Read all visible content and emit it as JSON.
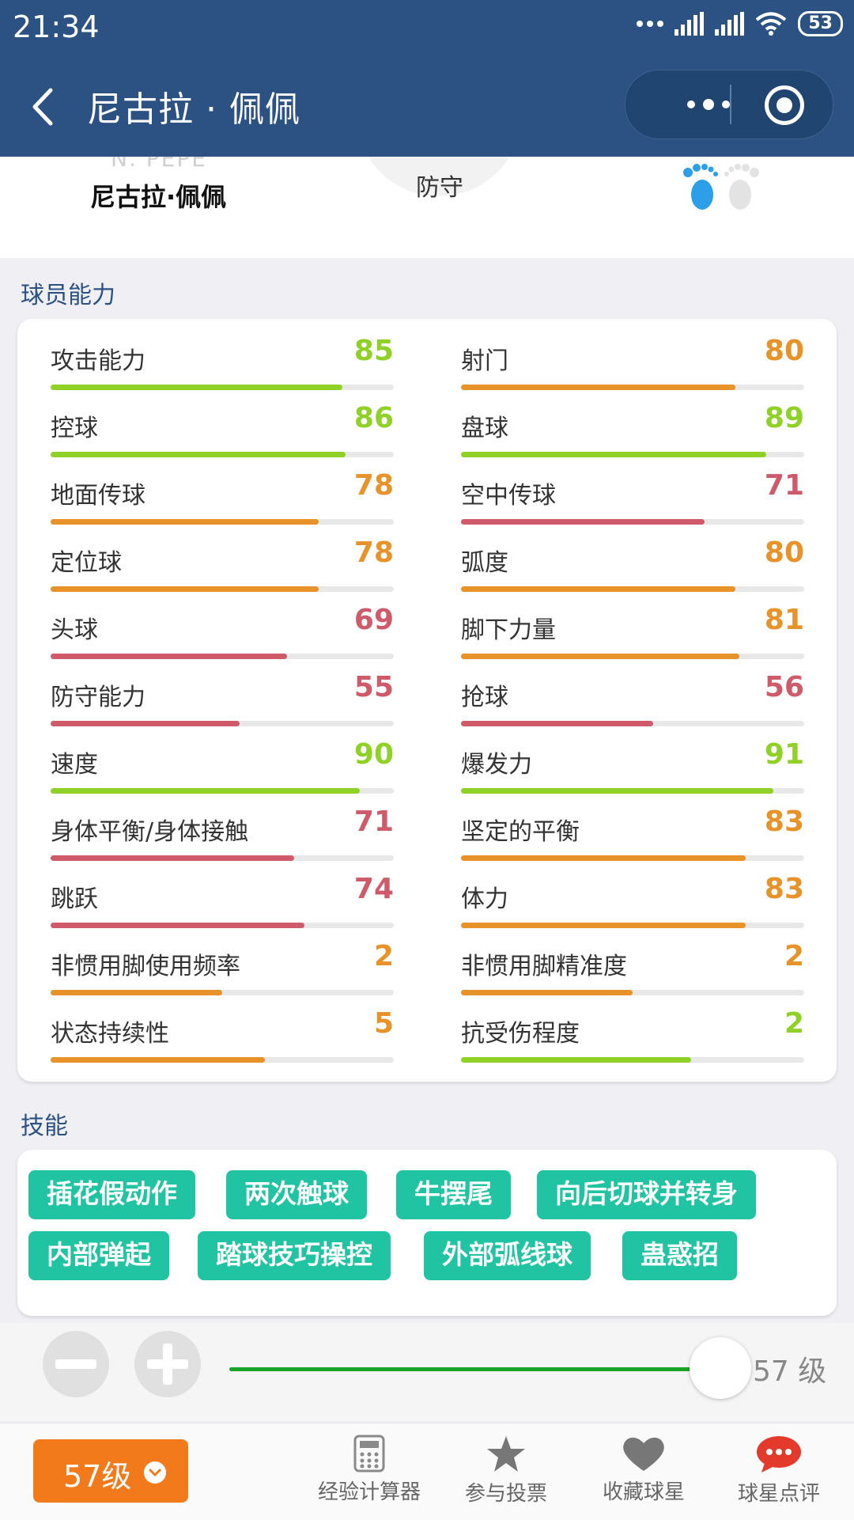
{
  "status_bar": {
    "time": "21:34",
    "battery": "53"
  },
  "nav": {
    "title": "尼古拉 · 佩佩"
  },
  "player": {
    "en_name": "N. PEPE",
    "cn_name": "尼古拉·佩佩",
    "position": "防守"
  },
  "stats_section_title": "球员能力",
  "stats": [
    {
      "label": "攻击能力",
      "value": "85",
      "pct": 0.85,
      "color": "#8fd126"
    },
    {
      "label": "射门",
      "value": "80",
      "pct": 0.8,
      "color": "#e8922a"
    },
    {
      "label": "控球",
      "value": "86",
      "pct": 0.86,
      "color": "#8fd126"
    },
    {
      "label": "盘球",
      "value": "89",
      "pct": 0.89,
      "color": "#8fd126"
    },
    {
      "label": "地面传球",
      "value": "78",
      "pct": 0.78,
      "color": "#e8922a"
    },
    {
      "label": "空中传球",
      "value": "71",
      "pct": 0.71,
      "color": "#cf5a6a"
    },
    {
      "label": "定位球",
      "value": "78",
      "pct": 0.78,
      "color": "#e8922a"
    },
    {
      "label": "弧度",
      "value": "80",
      "pct": 0.8,
      "color": "#e8922a"
    },
    {
      "label": "头球",
      "value": "69",
      "pct": 0.69,
      "color": "#cf5a6a"
    },
    {
      "label": "脚下力量",
      "value": "81",
      "pct": 0.81,
      "color": "#e8922a"
    },
    {
      "label": "防守能力",
      "value": "55",
      "pct": 0.55,
      "color": "#cf5a6a"
    },
    {
      "label": "抢球",
      "value": "56",
      "pct": 0.56,
      "color": "#cf5a6a"
    },
    {
      "label": "速度",
      "value": "90",
      "pct": 0.9,
      "color": "#8fd126"
    },
    {
      "label": "爆发力",
      "value": "91",
      "pct": 0.91,
      "color": "#8fd126"
    },
    {
      "label": "身体平衡/身体接触",
      "value": "71",
      "pct": 0.71,
      "color": "#cf5a6a"
    },
    {
      "label": "坚定的平衡",
      "value": "83",
      "pct": 0.83,
      "color": "#e8922a"
    },
    {
      "label": "跳跃",
      "value": "74",
      "pct": 0.74,
      "color": "#cf5a6a"
    },
    {
      "label": "体力",
      "value": "83",
      "pct": 0.83,
      "color": "#e8922a"
    },
    {
      "label": "非惯用脚使用频率",
      "value": "2",
      "pct": 0.5,
      "color": "#e8922a"
    },
    {
      "label": "非惯用脚精准度",
      "value": "2",
      "pct": 0.5,
      "color": "#e8922a"
    },
    {
      "label": "状态持续性",
      "value": "5",
      "pct": 0.625,
      "color": "#e8922a"
    },
    {
      "label": "抗受伤程度",
      "value": "2",
      "pct": 0.67,
      "color": "#8fd126"
    }
  ],
  "skills_section_title": "技能",
  "skills": [
    "插花假动作",
    "两次触球",
    "牛摆尾",
    "向后切球并转身",
    "内部弹起",
    "踏球技巧操控",
    "外部弧线球",
    "蛊惑招"
  ],
  "level_control": {
    "level": "57",
    "unit": "级",
    "slider_fraction": 0.92
  },
  "tabbar": {
    "level_pill": "57级",
    "tabs": [
      {
        "label": "经验计算器",
        "icon": "calculator-icon"
      },
      {
        "label": "参与投票",
        "icon": "star-icon"
      },
      {
        "label": "收藏球星",
        "icon": "heart-icon"
      },
      {
        "label": "球星点评",
        "icon": "chat-bubble-icon"
      }
    ]
  },
  "colors": {
    "nav_bg": "#2b5283",
    "accent_green": "#8fd126",
    "orange": "#e8922a",
    "red": "#cf5a6a",
    "tag": "#21c4a2",
    "foot_blue": "#2d9ee8"
  }
}
